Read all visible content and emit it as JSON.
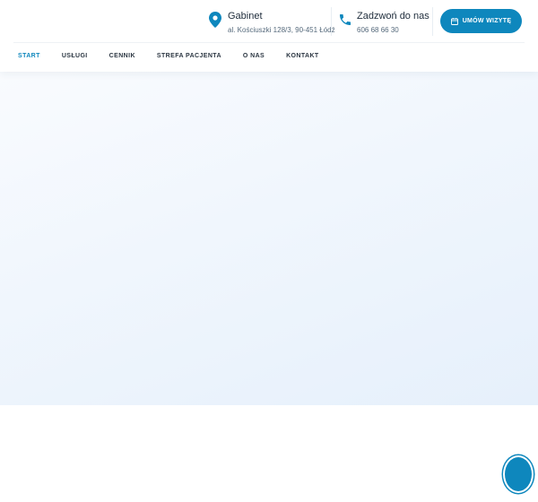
{
  "header": {
    "office": {
      "title": "Gabinet",
      "address": "al. Kościuszki 128/3, 90-451 Łódź",
      "icon": "map-pin-icon"
    },
    "phone": {
      "title": "Zadzwoń do nas",
      "number": "606 68 66 30",
      "icon": "phone-icon"
    },
    "cta": {
      "label": "UMÓW WIZYTĘ",
      "icon": "calendar-icon"
    }
  },
  "nav": {
    "items": [
      {
        "label": "START",
        "active": true
      },
      {
        "label": "USŁUGI",
        "active": false
      },
      {
        "label": "CENNIK",
        "active": false
      },
      {
        "label": "STREFA PACJENTA",
        "active": false
      },
      {
        "label": "O NAS",
        "active": false
      },
      {
        "label": "KONTAKT",
        "active": false
      }
    ]
  },
  "colors": {
    "accent": "#0e87bd",
    "text": "#1d2b3a",
    "hero_bg": "#eef5fc"
  }
}
